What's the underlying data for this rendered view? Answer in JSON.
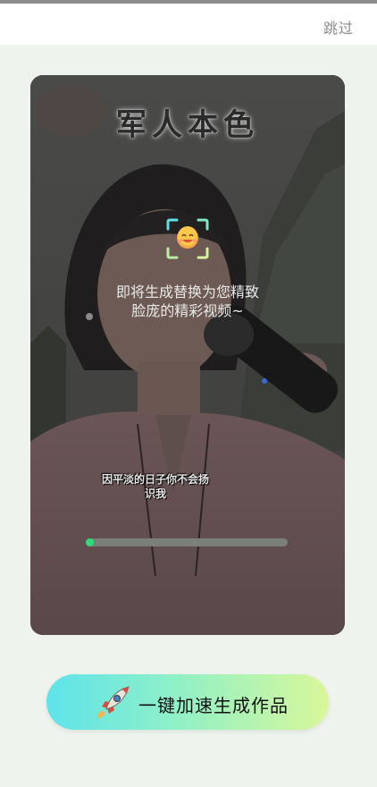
{
  "header": {
    "skip_label": "跳过"
  },
  "preview": {
    "overlay_title": "军人本色",
    "hint_line1": "即将生成替换为您精致",
    "hint_line2": "脸庞的精彩视频~",
    "subtitle_line1": "因平淡的日子你不会扬",
    "subtitle_line2": "识我",
    "progress_fraction": 0.03,
    "icons": [
      "face-scan-icon"
    ]
  },
  "cta": {
    "label": "一键加速生成作品",
    "icon": "rocket-icon"
  },
  "colors": {
    "background": "#eef3ee",
    "progress": "#2fdc7a",
    "cta_start": "#5ee3ea",
    "cta_end": "#d9f79a"
  }
}
